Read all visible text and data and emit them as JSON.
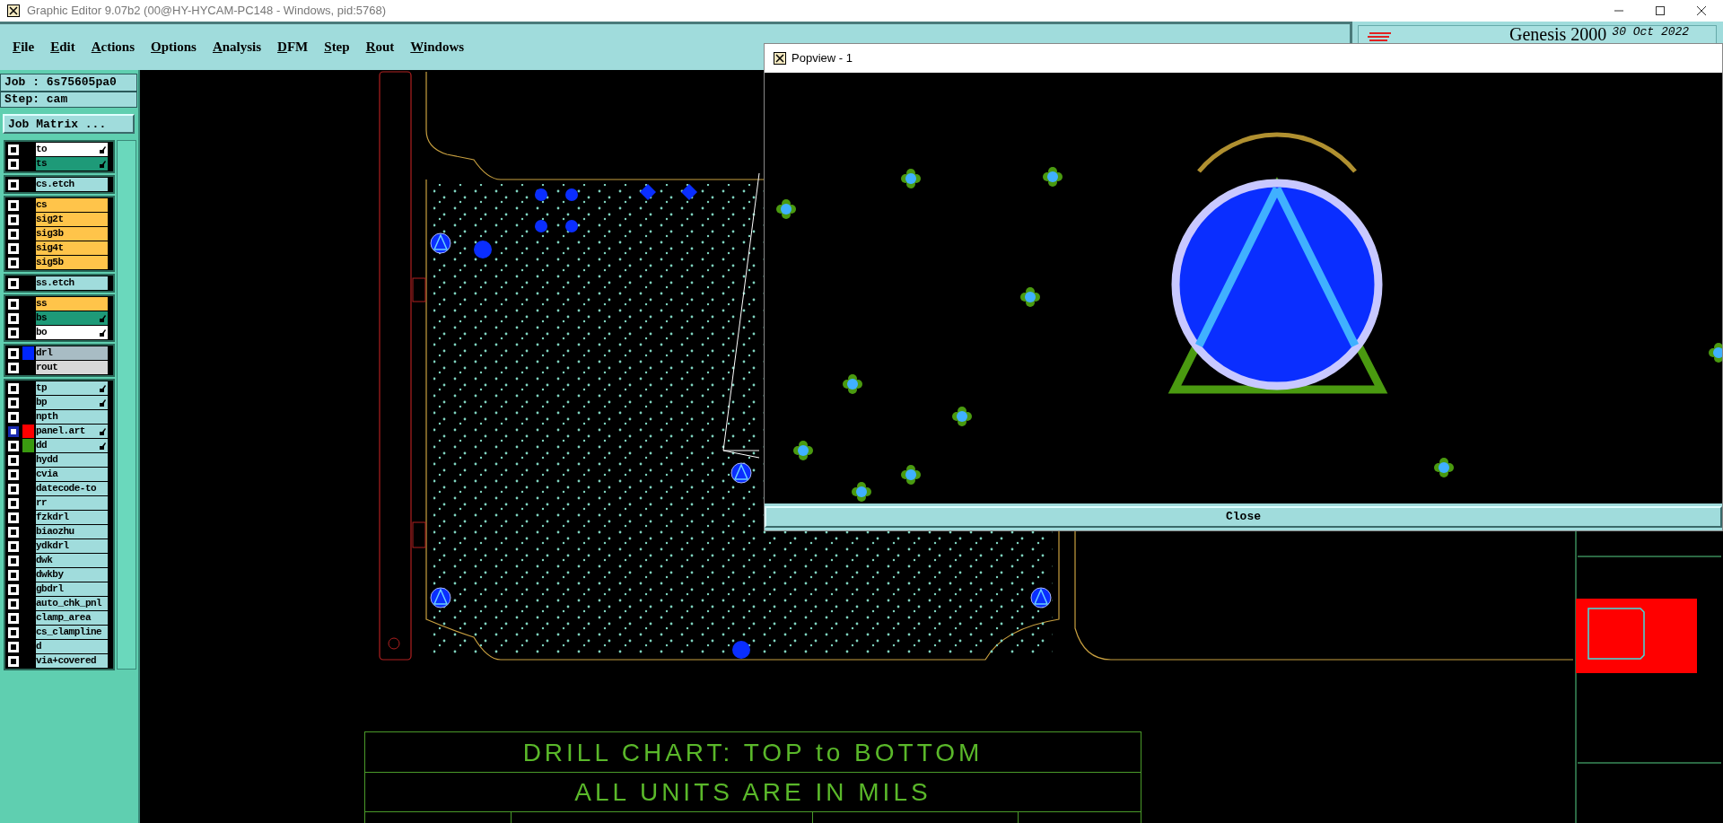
{
  "window": {
    "title": "Graphic Editor 9.07b2 (00@HY-HYCAM-PC148 - Windows, pid:5768)"
  },
  "menu": [
    "File",
    "Edit",
    "Actions",
    "Options",
    "Analysis",
    "DFM",
    "Step",
    "Rout",
    "Windows"
  ],
  "header": {
    "product": "Genesis 2000",
    "date": "30 Oct 2022"
  },
  "job_panel": {
    "job": "Job : 6s75605pa0",
    "step": "Step: cam",
    "matrix_button": "Job Matrix ..."
  },
  "layer_groups": [
    {
      "layers": [
        {
          "name": "to",
          "color": "#ffffff",
          "affected": true,
          "selected": false
        },
        {
          "name": "ts",
          "color": "#1e9a78",
          "affected": true,
          "selected": false
        }
      ]
    },
    {
      "layers": [
        {
          "name": "cs.etch",
          "color": "#a0dcdc",
          "affected": false,
          "selected": false
        }
      ]
    },
    {
      "layers": [
        {
          "name": "cs",
          "color": "#ffc44a",
          "affected": false,
          "selected": false
        },
        {
          "name": "sig2t",
          "color": "#ffc44a",
          "affected": false,
          "selected": false
        },
        {
          "name": "sig3b",
          "color": "#ffc44a",
          "affected": false,
          "selected": false
        },
        {
          "name": "sig4t",
          "color": "#ffc44a",
          "affected": false,
          "selected": false
        },
        {
          "name": "sig5b",
          "color": "#ffc44a",
          "affected": false,
          "selected": false
        }
      ]
    },
    {
      "layers": [
        {
          "name": "ss.etch",
          "color": "#a0dcdc",
          "affected": false,
          "selected": false
        }
      ]
    },
    {
      "layers": [
        {
          "name": "ss",
          "color": "#ffc44a",
          "affected": false,
          "selected": false
        },
        {
          "name": "bs",
          "color": "#1e9a78",
          "affected": true,
          "selected": false
        },
        {
          "name": "bo",
          "color": "#ffffff",
          "affected": true,
          "selected": false
        }
      ]
    },
    {
      "layers": [
        {
          "name": "drl",
          "color": "#a8bcc4",
          "marker": {
            "color": "#0026ff"
          },
          "affected": false,
          "selected": false
        },
        {
          "name": "rout",
          "color": "#d8d8d8",
          "affected": false,
          "selected": false
        }
      ]
    },
    {
      "layers": [
        {
          "name": "tp",
          "color": "#a0dcdc",
          "affected": true,
          "selected": false
        },
        {
          "name": "bp",
          "color": "#a0dcdc",
          "affected": true,
          "selected": false
        },
        {
          "name": "npth",
          "color": "#a0dcdc",
          "affected": false,
          "selected": false
        },
        {
          "name": "panel.art",
          "color": "#a0dcdc",
          "marker": {
            "color": "#ff0000"
          },
          "affected": true,
          "selected": true
        },
        {
          "name": "dd",
          "color": "#a0dcdc",
          "marker": {
            "color": "#3a9a10"
          },
          "affected": true,
          "selected": false
        },
        {
          "name": "hydd",
          "color": "#a0dcdc",
          "affected": false,
          "selected": false
        },
        {
          "name": "cvia",
          "color": "#a0dcdc",
          "affected": false,
          "selected": false
        },
        {
          "name": "datecode-to",
          "color": "#a0dcdc",
          "affected": false,
          "selected": false
        },
        {
          "name": "rr",
          "color": "#a0dcdc",
          "affected": false,
          "selected": false
        },
        {
          "name": "fzkdrl",
          "color": "#a0dcdc",
          "affected": false,
          "selected": false
        },
        {
          "name": "biaozhu",
          "color": "#a0dcdc",
          "affected": false,
          "selected": false
        },
        {
          "name": "ydkdrl",
          "color": "#a0dcdc",
          "affected": false,
          "selected": false
        },
        {
          "name": "dwk",
          "color": "#a0dcdc",
          "affected": false,
          "selected": false
        },
        {
          "name": "dwkby",
          "color": "#a0dcdc",
          "affected": false,
          "selected": false
        },
        {
          "name": "gbdrl",
          "color": "#a0dcdc",
          "affected": false,
          "selected": false
        },
        {
          "name": "auto_chk_pnl",
          "color": "#a0dcdc",
          "affected": false,
          "selected": false
        },
        {
          "name": "clamp_area",
          "color": "#a0dcdc",
          "affected": false,
          "selected": false
        },
        {
          "name": "cs_clampline",
          "color": "#a0dcdc",
          "affected": false,
          "selected": false
        },
        {
          "name": "d",
          "color": "#a0dcdc",
          "affected": false,
          "selected": false
        },
        {
          "name": "via+covered",
          "color": "#a0dcdc",
          "affected": false,
          "selected": false
        }
      ]
    }
  ],
  "popview": {
    "title": "Popview - 1",
    "close_button": "Close"
  },
  "drill_chart": {
    "rows": [
      "DRILL CHART: TOP to BOTTOM",
      "ALL UNITS ARE IN MILS"
    ]
  }
}
